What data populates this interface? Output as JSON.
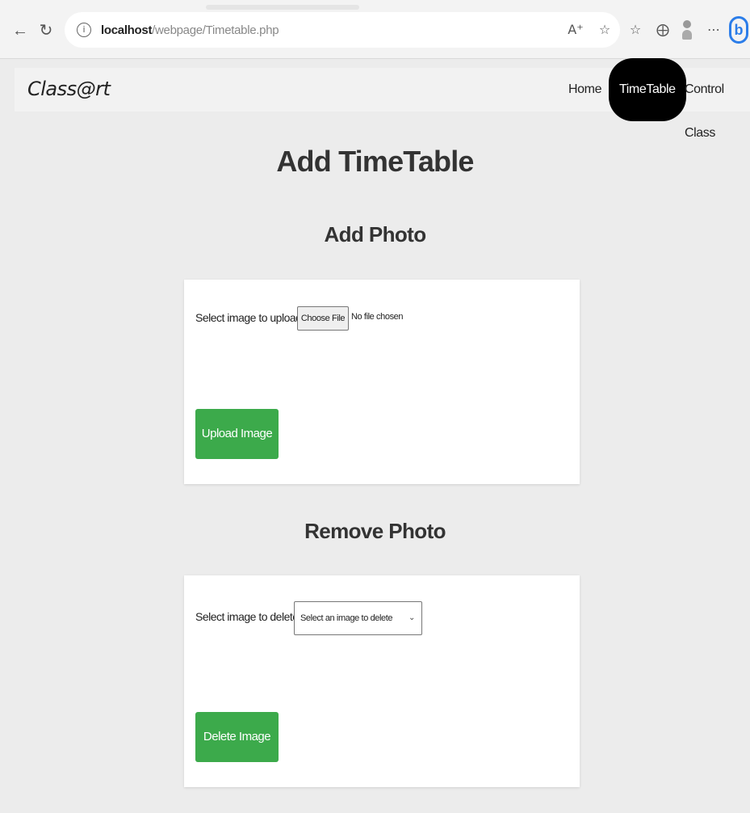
{
  "browser": {
    "url_host": "localhost",
    "url_path": "/webpage/Timetable.php"
  },
  "nav": {
    "logo": "Class@rt",
    "links": [
      "Home",
      "TimeTable",
      "Control Class"
    ],
    "active": "TimeTable"
  },
  "page": {
    "title": "Add TimeTable"
  },
  "add_photo": {
    "heading": "Add Photo",
    "label": "Select image to upload:",
    "choose_button": "Choose File",
    "file_status": "No file chosen",
    "submit": "Upload Image"
  },
  "remove_photo": {
    "heading": "Remove Photo",
    "label": "Select image to delete:",
    "select_value": "Select an image to delete",
    "submit": "Delete Image"
  },
  "colors": {
    "accent_green": "#3caa4b",
    "active_nav": "#000000",
    "background": "#ececec"
  }
}
